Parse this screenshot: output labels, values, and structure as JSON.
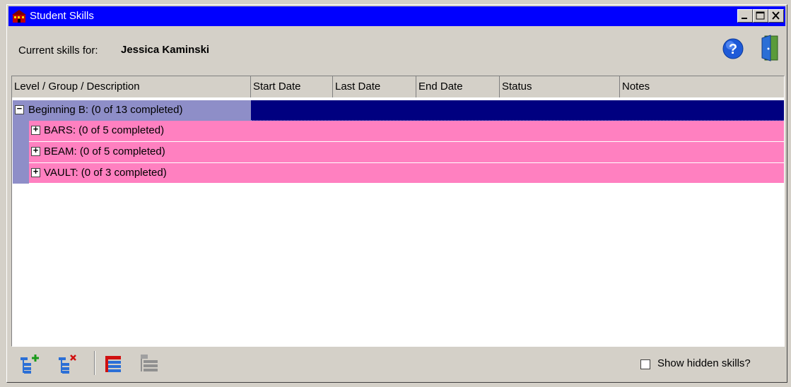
{
  "window": {
    "title": "Student Skills"
  },
  "header": {
    "label": "Current skills for:",
    "student_name": "Jessica Kaminski"
  },
  "columns": [
    "Level / Group / Description",
    "Start Date",
    "Last Date",
    "End Date",
    "Status",
    "Notes"
  ],
  "rows": {
    "level": {
      "toggle": "−",
      "label": "Beginning B:  (0 of 13 completed)"
    },
    "groups": [
      {
        "toggle": "+",
        "label": "BARS:  (0 of 5 completed)"
      },
      {
        "toggle": "+",
        "label": "BEAM:  (0 of 5 completed)"
      },
      {
        "toggle": "+",
        "label": "VAULT:  (0 of 3 completed)"
      }
    ]
  },
  "footer": {
    "show_hidden_label": "Show hidden skills?",
    "show_hidden_checked": false
  },
  "icons": {
    "app": "school-house-icon",
    "help": "help-icon",
    "exit": "exit-door-icon",
    "add": "add-skill-tree-icon",
    "remove": "remove-skill-tree-icon",
    "expand": "list-red-icon",
    "collapse": "list-gray-icon"
  },
  "colors": {
    "titlebar": "#0000ff",
    "level_row": "#8e8ec8",
    "level_fill": "#000080",
    "group_row": "#ff80c0"
  }
}
